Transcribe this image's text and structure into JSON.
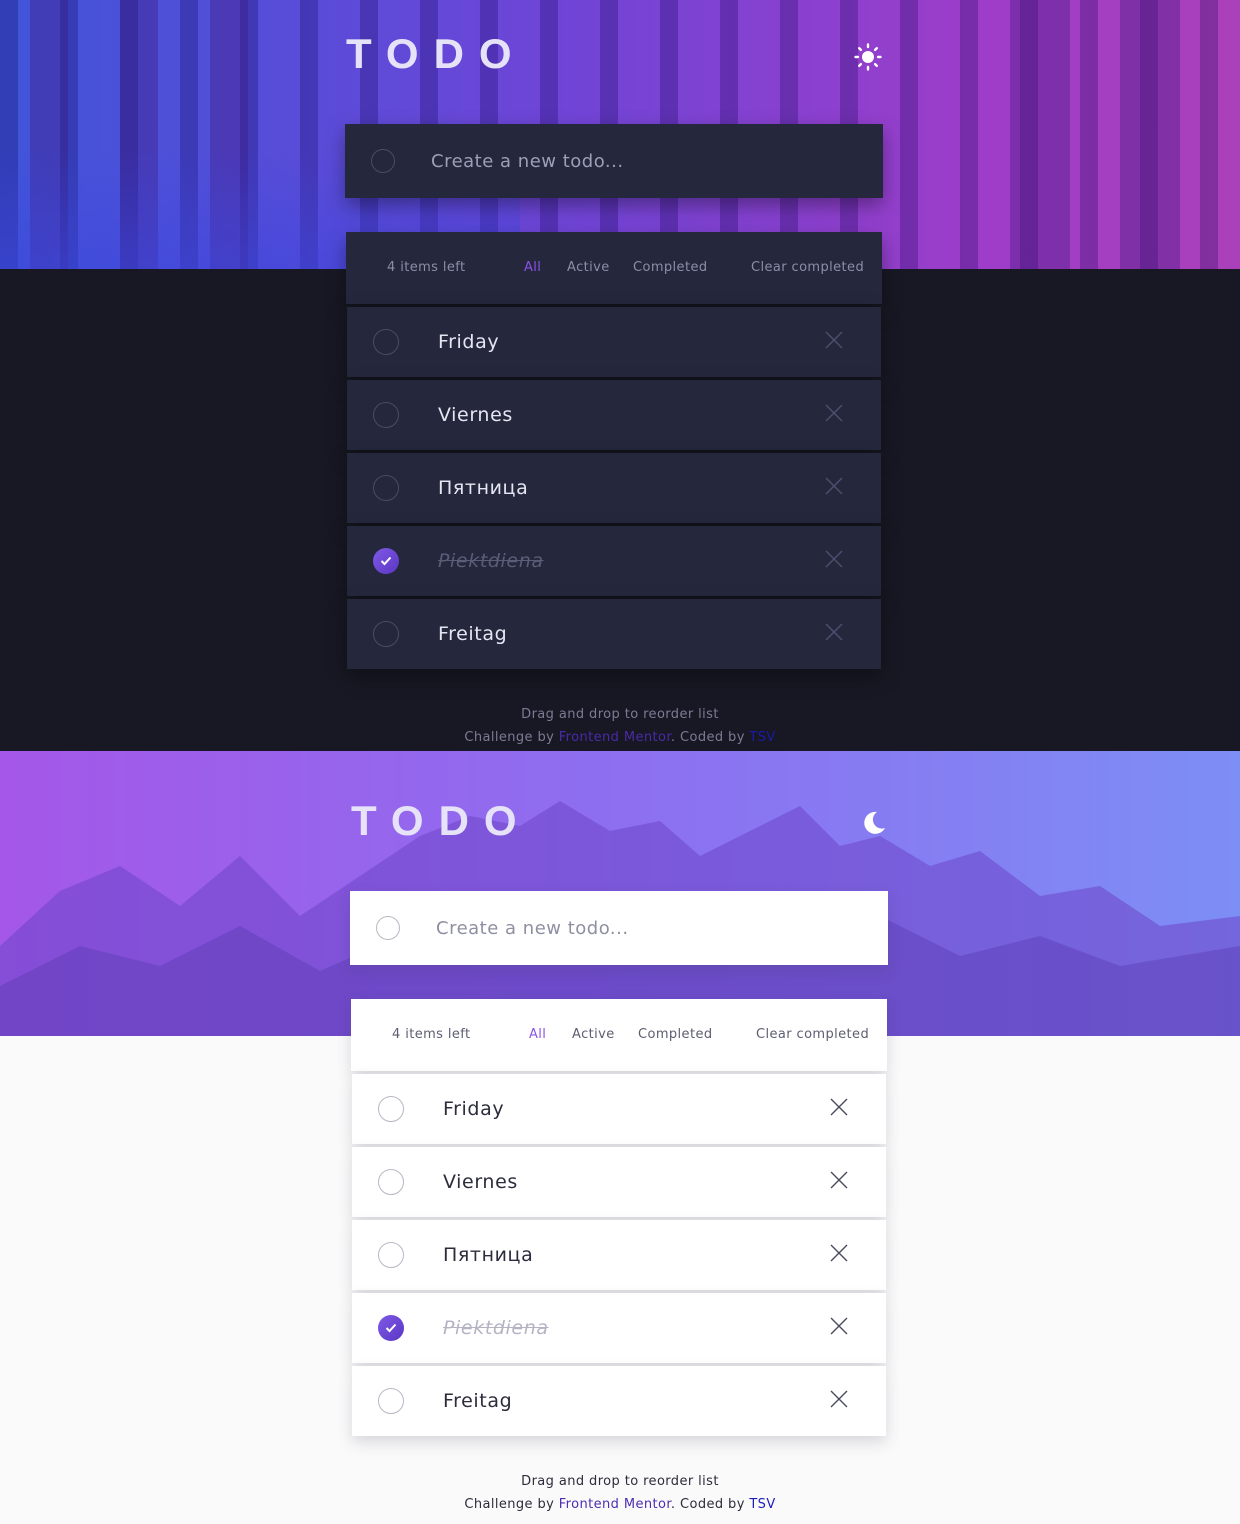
{
  "dark": {
    "title": "TODO",
    "toggle_icon": "sun-icon",
    "new_todo": {
      "placeholder": "Create a new todo..."
    },
    "filters": {
      "items_left": "4 items left",
      "all": "All",
      "active": "Active",
      "completed": "Completed",
      "clear": "Clear completed"
    },
    "todos": [
      {
        "text": "Friday",
        "completed": false
      },
      {
        "text": "Viernes",
        "completed": false
      },
      {
        "text": "Пятница",
        "completed": false
      },
      {
        "text": "Piektdiena",
        "completed": true
      },
      {
        "text": "Freitag",
        "completed": false
      }
    ],
    "footer": {
      "hint": "Drag and drop to reorder list",
      "challenge_prefix": "Challenge by ",
      "fm_link": "Frontend Mentor",
      "coded_by": ". Coded by ",
      "author": "TSV"
    }
  },
  "light": {
    "title": "TODO",
    "toggle_icon": "moon-icon",
    "new_todo": {
      "placeholder": "Create a new todo..."
    },
    "filters": {
      "items_left": "4 items left",
      "all": "All",
      "active": "Active",
      "completed": "Completed",
      "clear": "Clear completed"
    },
    "todos": [
      {
        "text": "Friday",
        "completed": false
      },
      {
        "text": "Viernes",
        "completed": false
      },
      {
        "text": "Пятница",
        "completed": false
      },
      {
        "text": "Piektdiena",
        "completed": true
      },
      {
        "text": "Freitag",
        "completed": false
      }
    ],
    "footer": {
      "hint": "Drag and drop to reorder list",
      "challenge_prefix": "Challenge by ",
      "fm_link": "Frontend Mentor",
      "coded_by": ". Coded by ",
      "author": "TSV"
    }
  },
  "colors": {
    "accent": "#8a52e6",
    "dark_bg": "#181824",
    "dark_card": "#25273d",
    "light_bg": "#fafafa",
    "light_card": "#ffffff"
  }
}
